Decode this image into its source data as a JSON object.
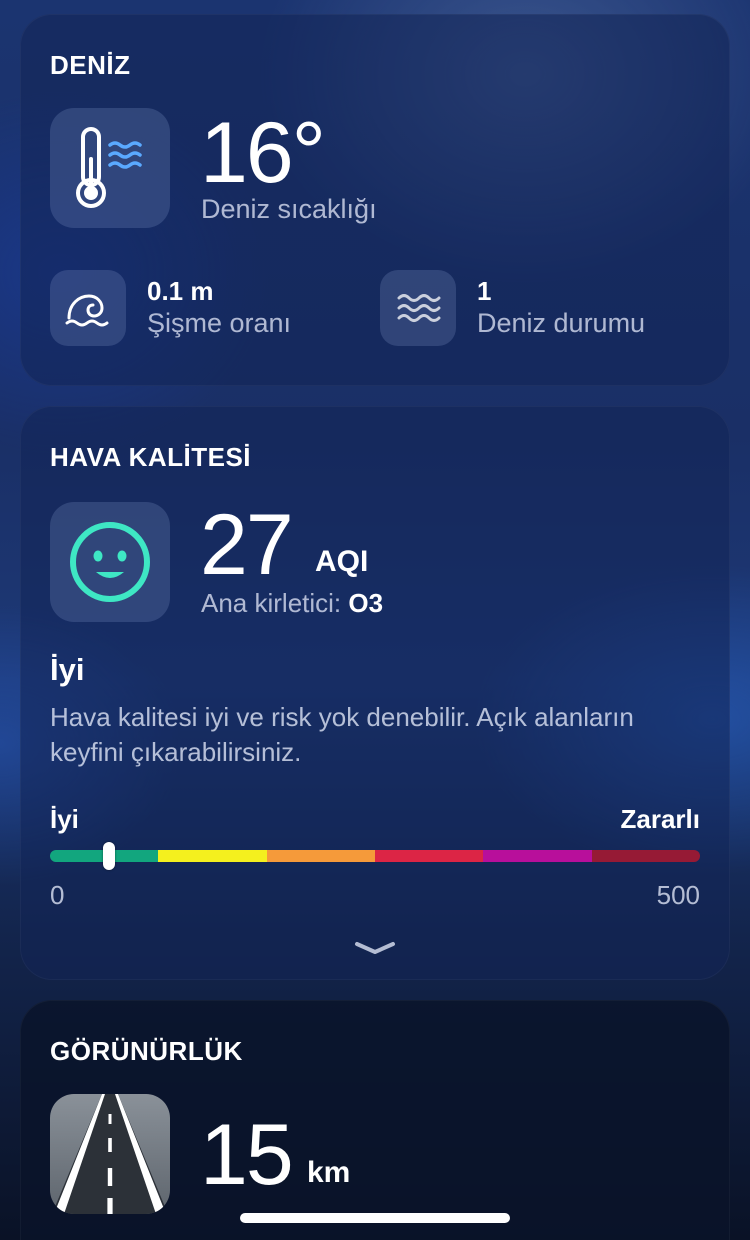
{
  "sea": {
    "title": "DENİZ",
    "temperature": "16°",
    "temperature_label": "Deniz sıcaklığı",
    "swell_value": "0.1 m",
    "swell_label": "Şişme oranı",
    "state_value": "1",
    "state_label": "Deniz durumu",
    "icons": [
      "thermometer-water-icon",
      "wave-icon",
      "water-waves-icon"
    ]
  },
  "air": {
    "title": "HAVA KALİTESİ",
    "aqi_value": "27",
    "aqi_unit": "AQI",
    "pollutant_prefix": "Ana kirletici:",
    "pollutant": "O3",
    "level": "İyi",
    "description": "Hava kalitesi iyi ve risk yok denebilir.  Açık alanların keyfini çıkarabilirsiniz.",
    "scale_low_label": "İyi",
    "scale_high_label": "Zararlı",
    "scale_min": "0",
    "scale_max": "500",
    "scale_position": 0.09,
    "scale_segments": [
      {
        "color": "#12a67e",
        "weight": 1
      },
      {
        "color": "#f4f01e",
        "weight": 1
      },
      {
        "color": "#f59a3a",
        "weight": 1
      },
      {
        "color": "#dc2545",
        "weight": 1
      },
      {
        "color": "#b80f9b",
        "weight": 1
      },
      {
        "color": "#961a35",
        "weight": 1
      }
    ],
    "icons": [
      "smiley-face-icon",
      "chevron-down-icon"
    ]
  },
  "visibility": {
    "title": "GÖRÜNÜRLÜK",
    "value": "15",
    "unit": "km",
    "icons": [
      "road-icon"
    ]
  }
}
